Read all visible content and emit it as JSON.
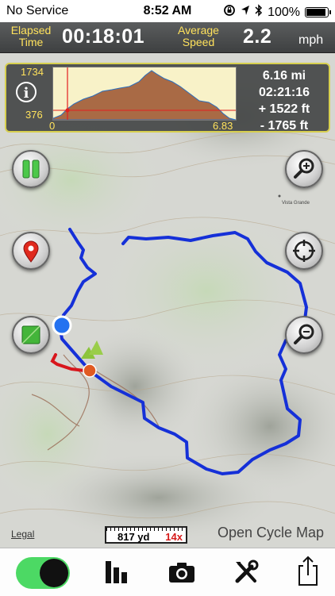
{
  "status_bar": {
    "carrier": "No Service",
    "time": "8:52 AM",
    "battery": "100%"
  },
  "stats": {
    "elapsed_label_1": "Elapsed",
    "elapsed_label_2": "Time",
    "elapsed_value": "00:18:01",
    "speed_label_1": "Average",
    "speed_label_2": "Speed",
    "speed_value": "2.2",
    "speed_unit": "mph"
  },
  "elevation": {
    "y_max": "1734",
    "y_min": "376",
    "x_min": "0",
    "x_max": "6.83",
    "distance": "6.16 mi",
    "duration": "02:21:16",
    "gain": "+ 1522 ft",
    "loss": "- 1765 ft"
  },
  "map": {
    "legal": "Legal",
    "scale_text": "817 yd",
    "zoom": "14x",
    "attribution": "Open Cycle Map",
    "place_label": "Vista Grande"
  },
  "colors": {
    "track": "#1530d8",
    "track_start": "#d8161c",
    "toggle": "#4cd964",
    "panel_border": "#d7cf4e",
    "label_yellow": "#ffe25c"
  },
  "icons": [
    "pause-icon",
    "map-pin-icon",
    "layer-square-icon",
    "zoom-in-icon",
    "recenter-icon",
    "zoom-out-icon",
    "stats-bars-icon",
    "camera-icon",
    "tools-icon",
    "share-icon"
  ]
}
